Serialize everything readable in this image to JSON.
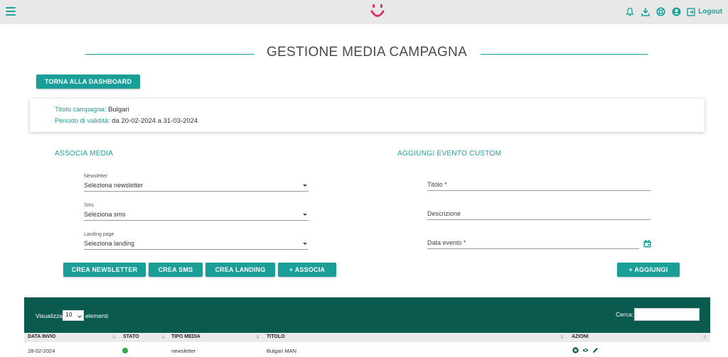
{
  "topbar": {
    "logout_label": "Logout",
    "icons": [
      "menu-icon",
      "bell-icon",
      "download-icon",
      "help-icon",
      "account-icon",
      "logout-icon"
    ]
  },
  "page": {
    "title": "GESTIONE MEDIA CAMPAGNA",
    "back_button": "TORNA ALLA DASHBOARD"
  },
  "campaign": {
    "title_label": "Titolo campagna:",
    "title_value": "Bulgari",
    "period_label": "Periodo di validità:",
    "period_value": "da 20-02-2024 a 31-03-2024"
  },
  "associa": {
    "heading": "ASSOCIA MEDIA",
    "newsletter_label": "Newsletter",
    "newsletter_value": "Seleziona newsletter",
    "sms_label": "Sms",
    "sms_value": "Seleziona sms",
    "landing_label": "Landing page",
    "landing_value": "Seleziona landing",
    "buttons": {
      "crea_newsletter": "CREA NEWSLETTER",
      "crea_sms": "CREA SMS",
      "crea_landing": "CREA LANDING",
      "associa": "+  ASSOCIA"
    }
  },
  "evento": {
    "heading": "AGGIUNGI EVENTO CUSTOM",
    "titolo_placeholder": "Titolo *",
    "descrizione_placeholder": "Descrizione",
    "data_placeholder": "Data evento *",
    "aggiungi": "+  AGGIUNGI"
  },
  "table": {
    "show_prefix": "Visualizza",
    "page_length": "10",
    "show_suffix": "elementi",
    "search_label": "Cerca:",
    "columns": [
      "DATA INVIO",
      "STATO",
      "TIPO MEDIA",
      "TITOLO",
      "AZIONI"
    ],
    "rows": [
      {
        "data_invio": "28-02-2024",
        "stato": "active",
        "tipo_media": "newsletter",
        "titolo": "Bulgari MAN"
      }
    ]
  },
  "colors": {
    "accent": "#1aa39a",
    "table_header": "#0b5a50",
    "logo": "#e0306a",
    "status_ok": "#2fa84f"
  }
}
